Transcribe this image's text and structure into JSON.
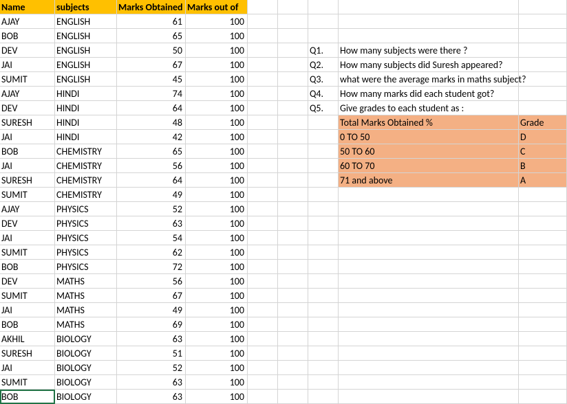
{
  "headers": {
    "name": "Name",
    "subjects": "subjects",
    "marks_obtained": "Marks Obtained",
    "marks_out_of": "Marks out of"
  },
  "rows": [
    {
      "name": "AJAY",
      "subject": "ENGLISH",
      "obt": "61",
      "out": "100"
    },
    {
      "name": "BOB",
      "subject": "ENGLISH",
      "obt": "65",
      "out": "100"
    },
    {
      "name": "DEV",
      "subject": "ENGLISH",
      "obt": "50",
      "out": "100"
    },
    {
      "name": "JAI",
      "subject": "ENGLISH",
      "obt": "67",
      "out": "100"
    },
    {
      "name": "SUMIT",
      "subject": "ENGLISH",
      "obt": "45",
      "out": "100"
    },
    {
      "name": "AJAY",
      "subject": "HINDI",
      "obt": "74",
      "out": "100"
    },
    {
      "name": "DEV",
      "subject": "HINDI",
      "obt": "64",
      "out": "100"
    },
    {
      "name": "SURESH",
      "subject": "HINDI",
      "obt": "48",
      "out": "100"
    },
    {
      "name": "JAI",
      "subject": "HINDI",
      "obt": "42",
      "out": "100"
    },
    {
      "name": "BOB",
      "subject": "CHEMISTRY",
      "obt": "65",
      "out": "100"
    },
    {
      "name": "JAI",
      "subject": "CHEMISTRY",
      "obt": "56",
      "out": "100"
    },
    {
      "name": "SURESH",
      "subject": "CHEMISTRY",
      "obt": "64",
      "out": "100"
    },
    {
      "name": "SUMIT",
      "subject": "CHEMISTRY",
      "obt": "49",
      "out": "100"
    },
    {
      "name": "AJAY",
      "subject": "PHYSICS",
      "obt": "52",
      "out": "100"
    },
    {
      "name": "DEV",
      "subject": "PHYSICS",
      "obt": "63",
      "out": "100"
    },
    {
      "name": "JAI",
      "subject": "PHYSICS",
      "obt": "54",
      "out": "100"
    },
    {
      "name": "SUMIT",
      "subject": "PHYSICS",
      "obt": "62",
      "out": "100"
    },
    {
      "name": "BOB",
      "subject": "PHYSICS",
      "obt": "72",
      "out": "100"
    },
    {
      "name": "DEV",
      "subject": "MATHS",
      "obt": "56",
      "out": "100"
    },
    {
      "name": "SUMIT",
      "subject": "MATHS",
      "obt": "67",
      "out": "100"
    },
    {
      "name": "JAI",
      "subject": "MATHS",
      "obt": "49",
      "out": "100"
    },
    {
      "name": "BOB",
      "subject": "MATHS",
      "obt": "69",
      "out": "100"
    },
    {
      "name": "AKHIL",
      "subject": "BIOLOGY",
      "obt": "63",
      "out": "100"
    },
    {
      "name": "SURESH",
      "subject": "BIOLOGY",
      "obt": "51",
      "out": "100"
    },
    {
      "name": "JAI",
      "subject": "BIOLOGY",
      "obt": "52",
      "out": "100"
    },
    {
      "name": "SUMIT",
      "subject": "BIOLOGY",
      "obt": "63",
      "out": "100"
    },
    {
      "name": "BOB",
      "subject": "BIOLOGY",
      "obt": "63",
      "out": "100"
    }
  ],
  "questions": [
    {
      "num": "Q1.",
      "text": "How many subjects were there ?"
    },
    {
      "num": "Q2.",
      "text": "How many subjects did Suresh appeared?"
    },
    {
      "num": "Q3.",
      "text": "what were the average marks in maths subject?"
    },
    {
      "num": "Q4.",
      "text": "How many marks did each student got?"
    },
    {
      "num": "Q5.",
      "text": "Give grades to each student as :"
    }
  ],
  "grade_table": {
    "header_left": "Total Marks Obtained %",
    "header_right": "Grade",
    "rows": [
      {
        "range": "0 TO 50",
        "grade": "D"
      },
      {
        "range": "50 TO 60",
        "grade": "C"
      },
      {
        "range": "60 TO 70",
        "grade": "B"
      },
      {
        "range": "71 and above",
        "grade": "A"
      }
    ]
  }
}
